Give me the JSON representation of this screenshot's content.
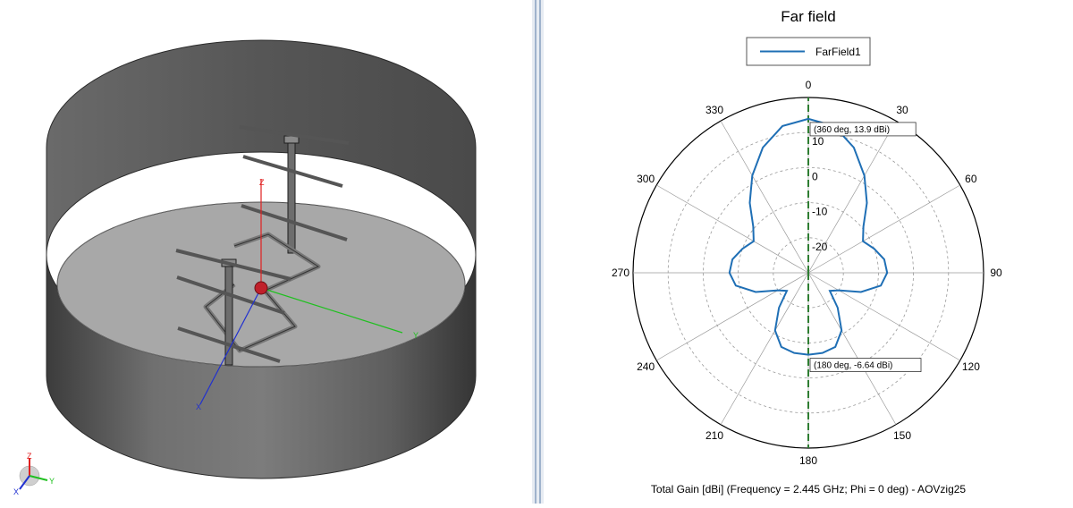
{
  "view3d": {
    "axis_labels": {
      "z": "Z",
      "y": "Y",
      "x": "X"
    },
    "triad_labels": {
      "z": "Z",
      "y": "Y",
      "x": "X"
    }
  },
  "colors": {
    "trace": "#1f6fb5",
    "marker_line": "#2e7d32",
    "grid": "#9a9a9a",
    "axis_x": "#2030d0",
    "axis_y": "#20c020",
    "axis_z": "#e02020"
  },
  "chart_data": {
    "type": "polar-line",
    "title": "Far field",
    "caption": "Total Gain [dBi] (Frequency = 2.445 GHz; Phi = 0 deg) - AOVzig25",
    "legend": {
      "position": "top",
      "entries": [
        "FarField1"
      ]
    },
    "radial_axis": {
      "min": -30,
      "max": 20,
      "unit": "dBi",
      "tick_labels": [
        "10",
        "0",
        "-10",
        "-20"
      ],
      "tick_values": [
        10,
        0,
        -10,
        -20
      ],
      "grid": true
    },
    "angular_axis": {
      "zero": "top",
      "direction": "clockwise",
      "tick_labels": [
        "0",
        "30",
        "60",
        "90",
        "120",
        "150",
        "180",
        "210",
        "240",
        "270",
        "300",
        "330"
      ]
    },
    "series": [
      {
        "name": "FarField1",
        "theta_deg": [
          0,
          10,
          20,
          30,
          40,
          50,
          60,
          70,
          80,
          90,
          100,
          110,
          120,
          130,
          140,
          150,
          160,
          170,
          180,
          190,
          200,
          210,
          220,
          230,
          240,
          250,
          260,
          270,
          280,
          290,
          300,
          310,
          320,
          330,
          340,
          350,
          360
        ],
        "gain_dbi": [
          13.9,
          12.5,
          8.0,
          2.0,
          -4.0,
          -9.5,
          -12.0,
          -10.0,
          -8.0,
          -7.5,
          -9.0,
          -14.0,
          -20.0,
          -22.0,
          -17.0,
          -11.0,
          -7.5,
          -6.8,
          -6.64,
          -6.8,
          -7.5,
          -11.0,
          -17.0,
          -22.0,
          -20.0,
          -14.0,
          -9.0,
          -7.5,
          -8.0,
          -10.0,
          -12.0,
          -9.5,
          -4.0,
          2.0,
          8.0,
          12.5,
          13.9
        ]
      }
    ],
    "markers": [
      {
        "theta_deg": 360,
        "gain_dbi": 13.9,
        "label": "(360 deg, 13.9 dBi)"
      },
      {
        "theta_deg": 180,
        "gain_dbi": -6.64,
        "label": "(180 deg, -6.64 dBi)"
      }
    ]
  }
}
